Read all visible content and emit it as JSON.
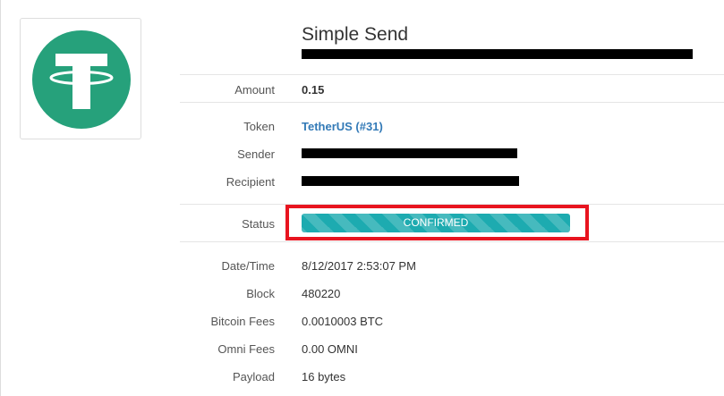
{
  "brand": {
    "logo_color": "#26a17b",
    "logo_glyph_color": "#ffffff"
  },
  "transaction": {
    "type_title": "Simple Send"
  },
  "fields": {
    "amount": {
      "label": "Amount",
      "value": "0.15"
    },
    "token": {
      "label": "Token",
      "value": "TetherUS (#31)"
    },
    "sender": {
      "label": "Sender"
    },
    "recipient": {
      "label": "Recipient"
    },
    "status": {
      "label": "Status",
      "value": "CONFIRMED"
    },
    "datetime": {
      "label": "Date/Time",
      "value": "8/12/2017 2:53:07 PM"
    },
    "block": {
      "label": "Block",
      "value": "480220"
    },
    "bitcoin_fees": {
      "label": "Bitcoin Fees",
      "value": "0.0010003 BTC"
    },
    "omni_fees": {
      "label": "Omni Fees",
      "value": "0.00 OMNI"
    },
    "payload": {
      "label": "Payload",
      "value": "16 bytes"
    }
  },
  "colors": {
    "status_bar": "#1dabb0",
    "highlight_box": "#e8141f",
    "link": "#337ab7"
  }
}
